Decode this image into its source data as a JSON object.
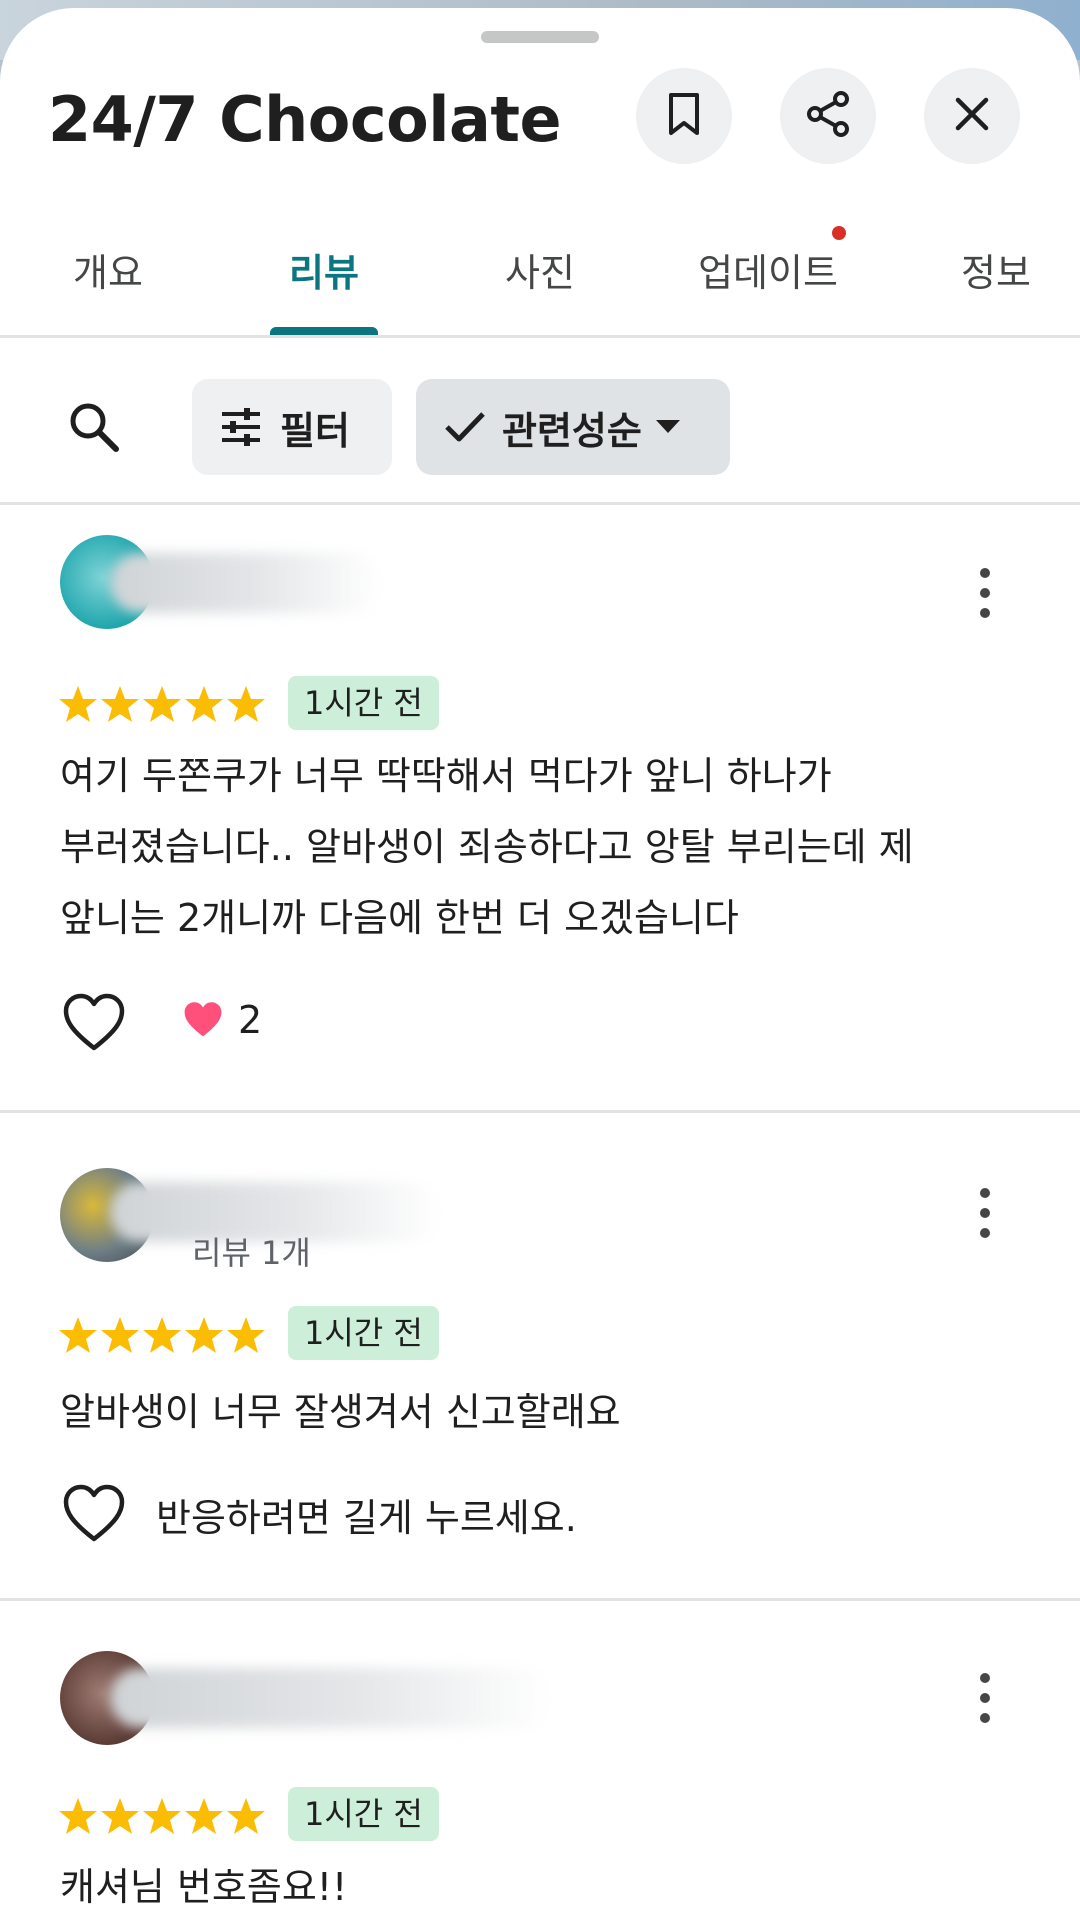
{
  "place": {
    "title": "24/7 Chocolate ..."
  },
  "header_actions": [
    {
      "name": "bookmark-icon"
    },
    {
      "name": "share-icon"
    },
    {
      "name": "close-icon"
    }
  ],
  "tabs": [
    {
      "label": "개요",
      "active": false
    },
    {
      "label": "리뷰",
      "active": true
    },
    {
      "label": "사진",
      "active": false
    },
    {
      "label": "업데이트",
      "active": false,
      "has_notification": true
    },
    {
      "label": "정보",
      "active": false
    }
  ],
  "filter_bar": {
    "filter_label": "필터",
    "sort_label": "관련성순"
  },
  "colors": {
    "accent": "#0b7680",
    "star": "#fbbc04",
    "time_badge": "#cdeed8",
    "notification": "#d93025"
  },
  "reviews": [
    {
      "rating": 5,
      "time": "1시간 전",
      "text_lines": [
        "여기 두쫀쿠가 너무 딱딱해서 먹다가 앞니 하나가",
        "부러졌습니다.. 알바생이 죄송하다고 앙탈 부리는데 제",
        "앞니는 2개니까 다음에 한번 더 오겠습니다"
      ],
      "reaction_count": "2"
    },
    {
      "rating": 5,
      "review_count": "리뷰 1개",
      "time": "1시간 전",
      "text_lines": [
        "알바생이 너무 잘생겨서 신고할래요"
      ],
      "reaction_hint": "반응하려면 길게 누르세요."
    },
    {
      "rating": 5,
      "time": "1시간 전",
      "text_lines": [
        "캐셔님 번호좀요!!"
      ]
    }
  ]
}
